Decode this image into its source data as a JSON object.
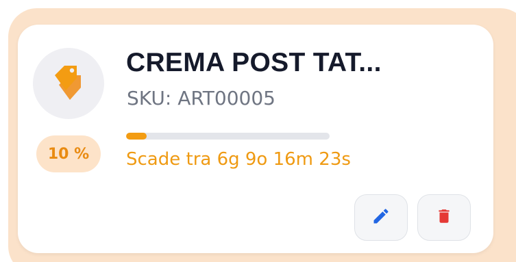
{
  "product": {
    "title": "CREMA POST TAT...",
    "sku": "SKU: ART00005",
    "discount": "10 %",
    "countdown": "Scade tra 6g 9o 16m 23s",
    "progress": 0.1,
    "icon": "tags-icon"
  },
  "actions": {
    "edit_icon": "pencil-icon",
    "delete_icon": "trash-icon"
  },
  "colors": {
    "accent_orange": "#f39c12",
    "discount_bg": "#fde3c9",
    "card_glow": "#fbe2ca",
    "edit_blue": "#2266e3",
    "delete_red": "#e53935",
    "title": "#151a2b"
  }
}
